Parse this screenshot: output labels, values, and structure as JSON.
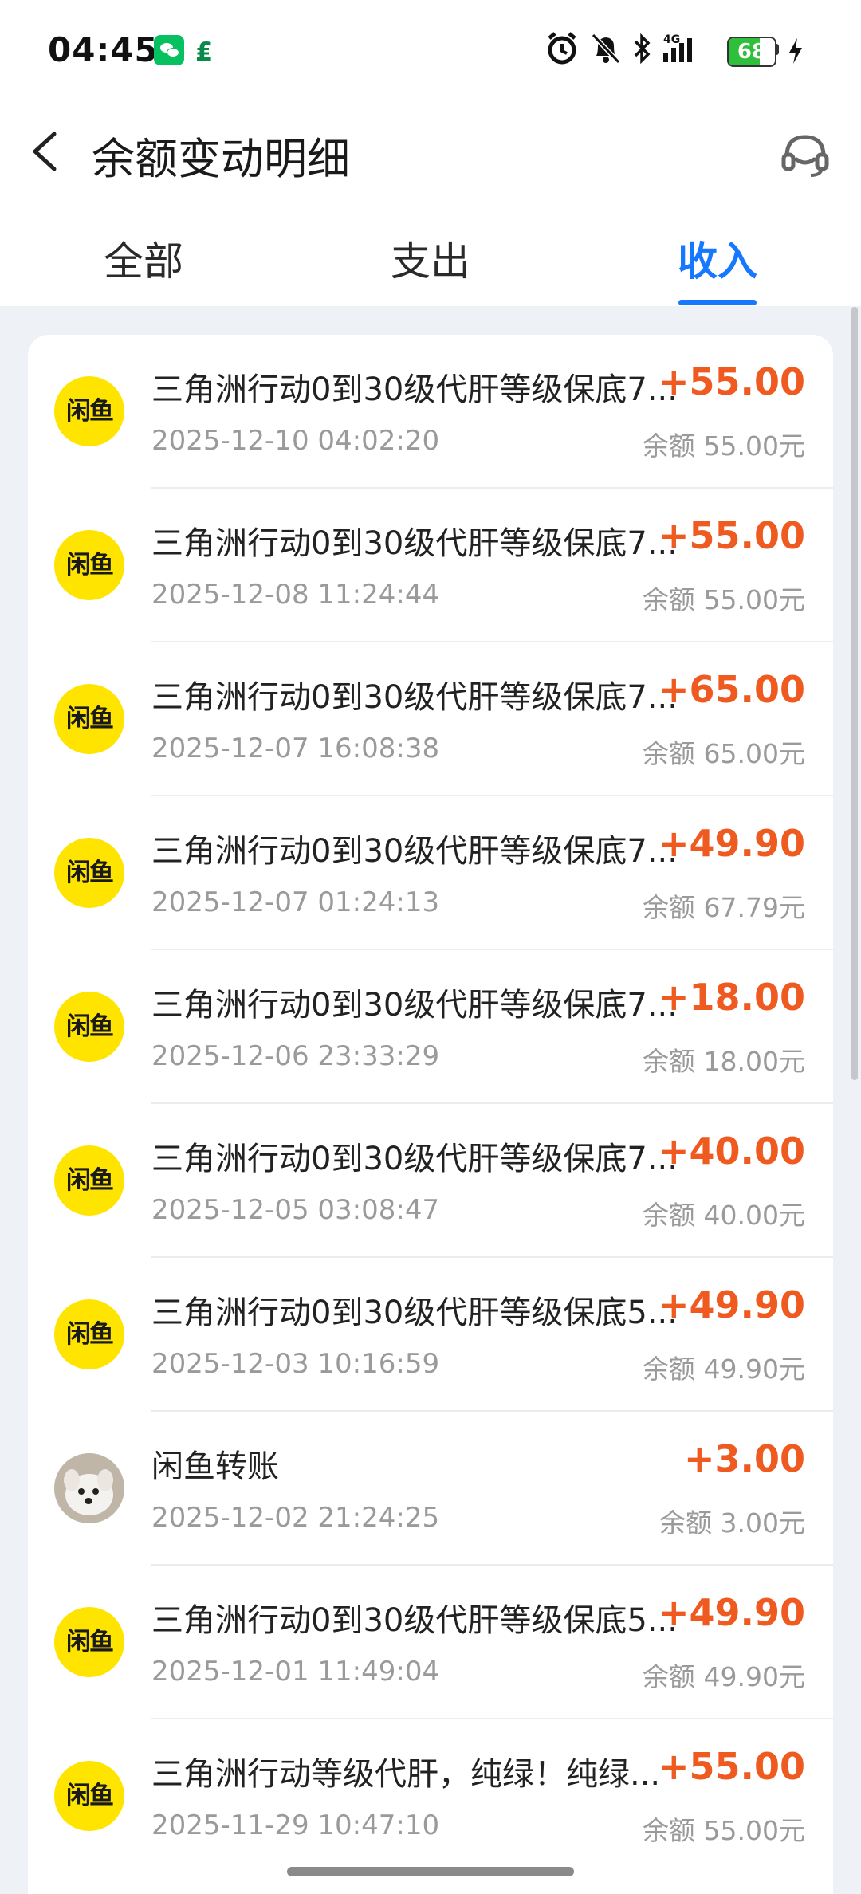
{
  "status_bar": {
    "time": "04:45",
    "battery": "68",
    "icons": [
      "wechat-icon",
      "postal-icon",
      "alarm-icon",
      "silent-bell-icon",
      "bluetooth-icon",
      "signal-4g-icon",
      "charging-icon"
    ]
  },
  "header": {
    "title": "余额变动明细",
    "back_icon": "chevron-left-icon",
    "service_icon": "customer-service-icon"
  },
  "tabs": [
    {
      "label": "全部",
      "active": false
    },
    {
      "label": "支出",
      "active": false
    },
    {
      "label": "收入",
      "active": true
    }
  ],
  "transactions": [
    {
      "avatar": "闲鱼",
      "title": "三角洲行动0到30级代肝等级保底7...",
      "time": "2025-12-10 04:02:20",
      "amount": "+55.00",
      "balance": "余额 55.00元"
    },
    {
      "avatar": "闲鱼",
      "title": "三角洲行动0到30级代肝等级保底7...",
      "time": "2025-12-08 11:24:44",
      "amount": "+55.00",
      "balance": "余额 55.00元"
    },
    {
      "avatar": "闲鱼",
      "title": "三角洲行动0到30级代肝等级保底7...",
      "time": "2025-12-07 16:08:38",
      "amount": "+65.00",
      "balance": "余额 65.00元"
    },
    {
      "avatar": "闲鱼",
      "title": "三角洲行动0到30级代肝等级保底7...",
      "time": "2025-12-07 01:24:13",
      "amount": "+49.90",
      "balance": "余额 67.79元"
    },
    {
      "avatar": "闲鱼",
      "title": "三角洲行动0到30级代肝等级保底7...",
      "time": "2025-12-06 23:33:29",
      "amount": "+18.00",
      "balance": "余额 18.00元"
    },
    {
      "avatar": "闲鱼",
      "title": "三角洲行动0到30级代肝等级保底7...",
      "time": "2025-12-05 03:08:47",
      "amount": "+40.00",
      "balance": "余额 40.00元"
    },
    {
      "avatar": "闲鱼",
      "title": "三角洲行动0到30级代肝等级保底5...",
      "time": "2025-12-03 10:16:59",
      "amount": "+49.90",
      "balance": "余额 49.90元"
    },
    {
      "avatar": "",
      "title": "闲鱼转账",
      "time": "2025-12-02 21:24:25",
      "amount": "+3.00",
      "balance": "余额 3.00元"
    },
    {
      "avatar": "闲鱼",
      "title": "三角洲行动0到30级代肝等级保底5...",
      "time": "2025-12-01 11:49:04",
      "amount": "+49.90",
      "balance": "余额 49.90元"
    },
    {
      "avatar": "闲鱼",
      "title": "三角洲行动等级代肝，纯绿！纯绿...",
      "time": "2025-11-29 10:47:10",
      "amount": "+55.00",
      "balance": "余额 55.00元"
    }
  ],
  "colors": {
    "accent": "#1677ff",
    "income": "#ee5a1f",
    "xianyu_yellow": "#ffe400"
  }
}
